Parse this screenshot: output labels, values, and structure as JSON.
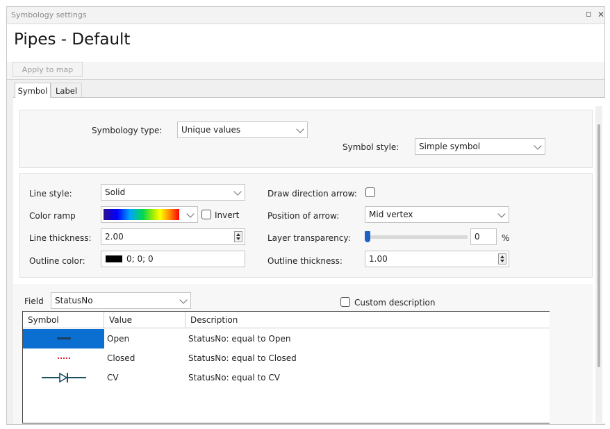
{
  "window": {
    "title": "Symbology settings",
    "restore_glyph": "▫",
    "close_glyph": "✕"
  },
  "header": {
    "title": "Pipes - Default"
  },
  "toolbar": {
    "apply_label": "Apply to map"
  },
  "tabs": [
    {
      "label": "Symbol",
      "active": true
    },
    {
      "label": "Label",
      "active": false
    }
  ],
  "symbology": {
    "type_label": "Symbology type:",
    "type_value": "Unique values",
    "style_label": "Symbol style:",
    "style_value": "Simple symbol"
  },
  "line": {
    "line_style_label": "Line style:",
    "line_style_value": "Solid",
    "color_ramp_label": "Color ramp",
    "invert_label": "Invert",
    "invert_checked": false,
    "thickness_label": "Line thickness:",
    "thickness_value": "2.00",
    "outline_color_label": "Outline color:",
    "outline_color_value": "0; 0; 0",
    "outline_color_hex": "#000000",
    "draw_arrow_label": "Draw direction arrow:",
    "draw_arrow_checked": false,
    "arrow_position_label": "Position of arrow:",
    "arrow_position_value": "Mid vertex",
    "transparency_label": "Layer transparency:",
    "transparency_value": "0",
    "transparency_unit": "%",
    "outline_thickness_label": "Outline thickness:",
    "outline_thickness_value": "1.00"
  },
  "field": {
    "label": "Field",
    "value": "StatusNo",
    "custom_description_label": "Custom description",
    "custom_description_checked": false
  },
  "table": {
    "columns": [
      "Symbol",
      "Value",
      "Description"
    ],
    "rows": [
      {
        "symbol": "solid-line-symbol",
        "value": "Open",
        "description": "StatusNo: equal to Open",
        "selected": true
      },
      {
        "symbol": "dotted-red-line-symbol",
        "value": "Closed",
        "description": "StatusNo: equal to Closed",
        "selected": false
      },
      {
        "symbol": "check-valve-symbol",
        "value": "CV",
        "description": "StatusNo: equal to CV",
        "selected": false
      }
    ]
  },
  "colors": {
    "accent": "#0a6fd0",
    "thumb": "#1c62c4",
    "closed_line": "#e0242c",
    "cv_line": "#1a4f66"
  }
}
